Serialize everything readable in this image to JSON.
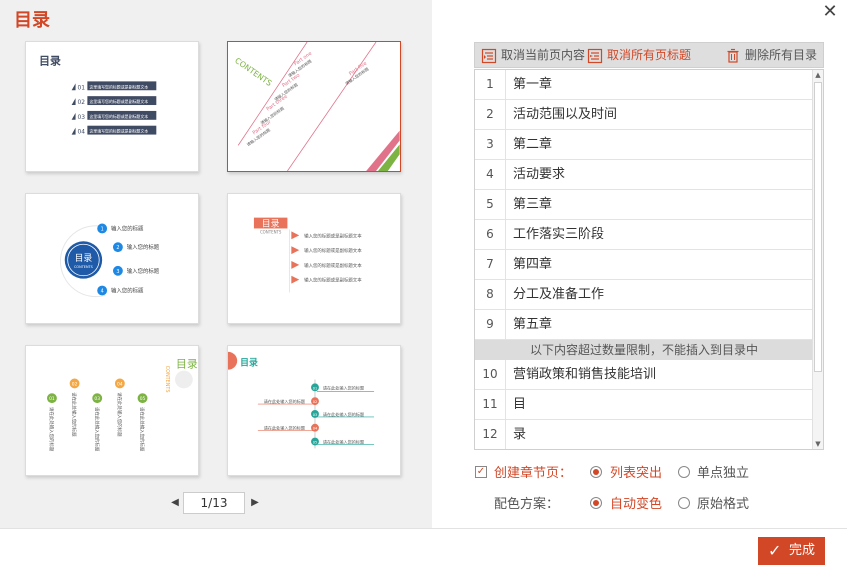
{
  "dialog": {
    "title": "目录",
    "close_glyph": "✕"
  },
  "thumbnails": [
    {
      "title": "目录",
      "items": [
        {
          "num": "01",
          "text": "这里填写您的标题或是副标题文本"
        },
        {
          "num": "02",
          "text": "这里填写您的标题或是副标题文本"
        },
        {
          "num": "03",
          "text": "这里填写您的标题或是副标题文本"
        },
        {
          "num": "04",
          "text": "这里填写您的标题或是副标题文本"
        }
      ]
    },
    {
      "contents": "CONTENTS",
      "parts": [
        "Part one",
        "Part two",
        "Part three",
        "Part four",
        "Part five"
      ],
      "sub": "请输入您的标题"
    },
    {
      "title": "目录",
      "sub": "CONTENTS",
      "items": [
        {
          "num": "1",
          "text": "输入您的标题"
        },
        {
          "num": "2",
          "text": "输入您的标题"
        },
        {
          "num": "3",
          "text": "输入您的标题"
        },
        {
          "num": "4",
          "text": "输入您的标题"
        }
      ]
    },
    {
      "title": "目录",
      "sub": "CONTENTS",
      "items": [
        "输入您的标题或是副标题文本",
        "输入您的标题或是副标题文本",
        "输入您的标题或是副标题文本",
        "输入您的标题或是副标题文本"
      ]
    },
    {
      "title": "目录",
      "sub": "CONTENTS",
      "items": [
        {
          "num": "01",
          "text": "请在此处输入您的标题"
        },
        {
          "num": "02",
          "text": "请在此处输入您的标题"
        },
        {
          "num": "03",
          "text": "请在此处输入您的标题"
        },
        {
          "num": "04",
          "text": "请在此处输入您的标题"
        },
        {
          "num": "05",
          "text": "请在此处输入您的标题"
        }
      ]
    },
    {
      "title": "目录",
      "items": [
        {
          "num": "01",
          "text": "请在此处输入您的标题"
        },
        {
          "num": "02",
          "text": "请在此处输入您的标题"
        },
        {
          "num": "03",
          "text": "请在此处输入您的标题"
        },
        {
          "num": "04",
          "text": "请在此处输入您的标题"
        },
        {
          "num": "05",
          "text": "请在此处输入您的标题"
        }
      ]
    }
  ],
  "pager": {
    "prev": "◀",
    "next": "▶",
    "value": "1/13"
  },
  "toolbar": {
    "cancel_current": "取消当前页内容",
    "cancel_all_headings": "取消所有页标题",
    "delete_all": "删除所有目录"
  },
  "list": {
    "rows": [
      {
        "num": "1",
        "text": "第一章"
      },
      {
        "num": "2",
        "text": "活动范围以及时间"
      },
      {
        "num": "3",
        "text": "第二章"
      },
      {
        "num": "4",
        "text": "活动要求"
      },
      {
        "num": "5",
        "text": "第三章"
      },
      {
        "num": "6",
        "text": "工作落实三阶段"
      },
      {
        "num": "7",
        "text": "第四章"
      },
      {
        "num": "8",
        "text": "分工及准备工作"
      },
      {
        "num": "9",
        "text": "第五章"
      }
    ],
    "limit_notice": "以下内容超过数量限制，不能插入到目录中",
    "overflow_rows": [
      {
        "num": "10",
        "text": "营销政策和销售技能培训"
      },
      {
        "num": "11",
        "text": "目"
      },
      {
        "num": "12",
        "text": "录"
      }
    ],
    "scroll_up": "▲",
    "scroll_down": "▼"
  },
  "options": {
    "create_section": {
      "label": "创建章节页：",
      "checked": "✓"
    },
    "section_mode": [
      {
        "label": "列表突出",
        "selected": true
      },
      {
        "label": "单点独立",
        "selected": false
      }
    ],
    "color_label": "配色方案：",
    "color_mode": [
      {
        "label": "自动变色",
        "selected": true
      },
      {
        "label": "原始格式",
        "selected": false
      }
    ]
  },
  "footer": {
    "done_check": "✓",
    "done_label": "完成"
  },
  "colors": {
    "accent": "#d24726",
    "navy": "#3f4a63",
    "blue": "#1e88e5",
    "pink": "#e0738a",
    "green": "#7cb342",
    "orange": "#f4a742",
    "teal": "#26a69a"
  }
}
